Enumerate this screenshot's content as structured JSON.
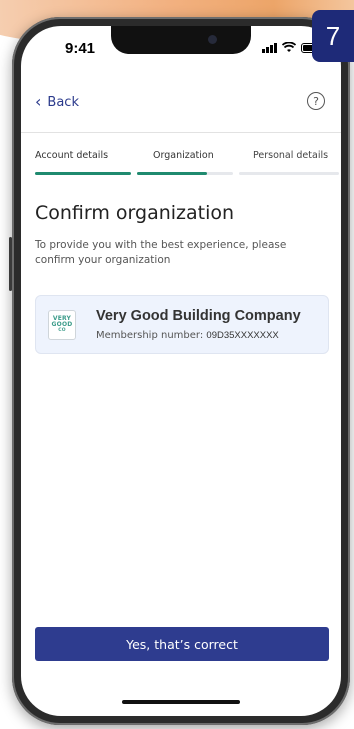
{
  "step_badge": "7",
  "status_bar": {
    "time": "9:41"
  },
  "nav": {
    "back_label": "Back",
    "help_icon_label": "?"
  },
  "tabs": [
    {
      "label": "Account details",
      "color": "#1f8a6f",
      "progress": 1.0
    },
    {
      "label": "Organization",
      "color": "#1f8a6f",
      "progress": 0.7
    },
    {
      "label": "Personal details",
      "color": "#e6e8ec",
      "progress": 0.0
    }
  ],
  "content": {
    "title": "Confirm organization",
    "subtitle": "To provide you with the best experience, please confirm your organization"
  },
  "organization": {
    "logo_lines": [
      "VERY",
      "GOOD",
      "CO"
    ],
    "name": "Very Good Building Company",
    "membership_label": "Membership number:",
    "membership_number": "09D35XXXXXXX"
  },
  "actions": {
    "confirm_label": "Yes, that’s correct"
  },
  "colors": {
    "primary": "#2e3c8f",
    "accent_green": "#1f8a6f",
    "badge": "#1e2a78"
  }
}
